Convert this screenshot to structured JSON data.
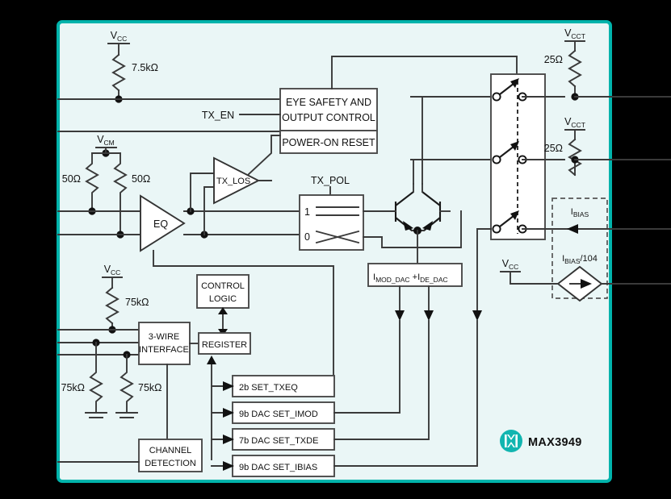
{
  "frame": {
    "background": "#eaf6f6",
    "border_color": "#00b3ab",
    "outer_background": "#000000"
  },
  "brand": {
    "name": "MAX3949",
    "logo_icon": "maxim-integrated-logo",
    "logo_color": "#12b5b0",
    "logo_glyph": "M"
  },
  "supplies": {
    "vcc_top": "V",
    "vcc_top_sub": "CC",
    "vcm": "V",
    "vcm_sub": "CM",
    "vcc_mid": "V",
    "vcc_mid_sub": "CC",
    "vcc_bias": "V",
    "vcc_bias_sub": "CC",
    "vcct_1": "V",
    "vcct_1_sub": "CCT",
    "vcct_2": "V",
    "vcct_2_sub": "CCT"
  },
  "resistors": {
    "pullup_7k5": "7.5kΩ",
    "term_left_50": "50Ω",
    "term_right_50": "50Ω",
    "pullup_75k": "75kΩ",
    "pulldown_75k_a": "75kΩ",
    "pulldown_75k_b": "75kΩ",
    "vcct_25_top": "25Ω",
    "vcct_25_bottom": "25Ω"
  },
  "signals": {
    "tx_en": "TX_EN",
    "tx_los": "TX_LOS",
    "tx_pol": "TX_POL",
    "eq": "EQ"
  },
  "mux": {
    "port_high": "1",
    "port_low": "0"
  },
  "blocks": {
    "eye_safety_line1": "EYE SAFETY AND",
    "eye_safety_line2": "OUTPUT CONTROL",
    "power_on_reset": "POWER-ON RESET",
    "control_logic_line1": "CONTROL",
    "control_logic_line2": "LOGIC",
    "register": "REGISTER",
    "three_wire_line1": "3-WIRE",
    "three_wire_line2": "INTERFACE",
    "channel_detect_line1": "CHANNEL",
    "channel_detect_line2": "DETECTION"
  },
  "current_source": {
    "imod_main": "I",
    "imod_sub": "MOD_DAC",
    "plus": "+",
    "ide_main": "I",
    "ide_sub": "DE_DAC"
  },
  "bias": {
    "ibias_main": "I",
    "ibias_sub": "BIAS",
    "ibias_div_main": "I",
    "ibias_div_sub": "BIAS",
    "ibias_div_tail": "/104"
  },
  "dacs": [
    {
      "label": "2b SET_TXEQ"
    },
    {
      "label": "9b DAC SET_IMOD"
    },
    {
      "label": "7b DAC SET_TXDE"
    },
    {
      "label": "9b DAC SET_IBIAS"
    }
  ]
}
